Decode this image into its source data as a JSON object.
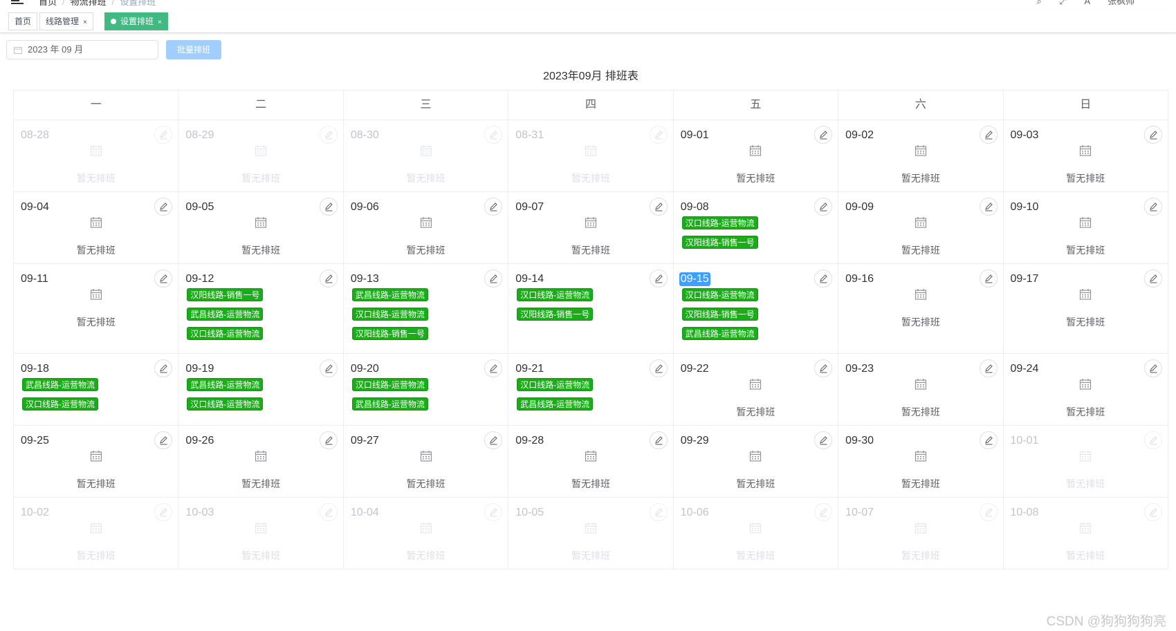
{
  "breadcrumb": {
    "items": [
      "首页",
      "物流排班",
      "设置排班"
    ]
  },
  "header_right": {
    "user": "张枫帅"
  },
  "tags": [
    {
      "label": "首页",
      "closable": false,
      "active": false
    },
    {
      "label": "线路管理",
      "closable": true,
      "active": false
    },
    {
      "label": "设置排班",
      "closable": true,
      "active": true
    }
  ],
  "toolbar": {
    "month_value": "2023 年 09 月",
    "batch_button": "批量排班"
  },
  "calendar": {
    "title": "2023年09月 排班表",
    "weekdays": [
      "一",
      "二",
      "三",
      "四",
      "五",
      "六",
      "日"
    ],
    "empty_text": "暂无排班",
    "weeks": [
      [
        {
          "date": "08-28",
          "other": true,
          "schedules": []
        },
        {
          "date": "08-29",
          "other": true,
          "schedules": []
        },
        {
          "date": "08-30",
          "other": true,
          "schedules": []
        },
        {
          "date": "08-31",
          "other": true,
          "schedules": []
        },
        {
          "date": "09-01",
          "other": false,
          "schedules": []
        },
        {
          "date": "09-02",
          "other": false,
          "schedules": []
        },
        {
          "date": "09-03",
          "other": false,
          "schedules": []
        }
      ],
      [
        {
          "date": "09-04",
          "other": false,
          "schedules": []
        },
        {
          "date": "09-05",
          "other": false,
          "schedules": []
        },
        {
          "date": "09-06",
          "other": false,
          "schedules": []
        },
        {
          "date": "09-07",
          "other": false,
          "schedules": []
        },
        {
          "date": "09-08",
          "other": false,
          "schedules": [
            "汉口线路-运营物流",
            "汉阳线路-销售一号"
          ]
        },
        {
          "date": "09-09",
          "other": false,
          "schedules": []
        },
        {
          "date": "09-10",
          "other": false,
          "schedules": []
        }
      ],
      [
        {
          "date": "09-11",
          "other": false,
          "schedules": []
        },
        {
          "date": "09-12",
          "other": false,
          "schedules": [
            "汉阳线路-销售一号",
            "武昌线路-运营物流",
            "汉口线路-运营物流"
          ]
        },
        {
          "date": "09-13",
          "other": false,
          "schedules": [
            "武昌线路-运营物流",
            "汉口线路-运营物流",
            "汉阳线路-销售一号"
          ]
        },
        {
          "date": "09-14",
          "other": false,
          "schedules": [
            "汉口线路-运营物流",
            "汉阳线路-销售一号"
          ]
        },
        {
          "date": "09-15",
          "other": false,
          "today": true,
          "schedules": [
            "汉口线路-运营物流",
            "汉阳线路-销售一号",
            "武昌线路-运营物流"
          ]
        },
        {
          "date": "09-16",
          "other": false,
          "schedules": []
        },
        {
          "date": "09-17",
          "other": false,
          "schedules": []
        }
      ],
      [
        {
          "date": "09-18",
          "other": false,
          "schedules": [
            "武昌线路-运营物流",
            "汉口线路-运营物流"
          ]
        },
        {
          "date": "09-19",
          "other": false,
          "schedules": [
            "武昌线路-运营物流",
            "汉口线路-运营物流"
          ]
        },
        {
          "date": "09-20",
          "other": false,
          "schedules": [
            "汉口线路-运营物流",
            "武昌线路-运营物流"
          ]
        },
        {
          "date": "09-21",
          "other": false,
          "schedules": [
            "汉口线路-运营物流",
            "武昌线路-运营物流"
          ]
        },
        {
          "date": "09-22",
          "other": false,
          "schedules": []
        },
        {
          "date": "09-23",
          "other": false,
          "schedules": []
        },
        {
          "date": "09-24",
          "other": false,
          "schedules": []
        }
      ],
      [
        {
          "date": "09-25",
          "other": false,
          "schedules": []
        },
        {
          "date": "09-26",
          "other": false,
          "schedules": []
        },
        {
          "date": "09-27",
          "other": false,
          "schedules": []
        },
        {
          "date": "09-28",
          "other": false,
          "schedules": []
        },
        {
          "date": "09-29",
          "other": false,
          "schedules": []
        },
        {
          "date": "09-30",
          "other": false,
          "schedules": []
        },
        {
          "date": "10-01",
          "other": true,
          "schedules": []
        }
      ],
      [
        {
          "date": "10-02",
          "other": true,
          "schedules": []
        },
        {
          "date": "10-03",
          "other": true,
          "schedules": []
        },
        {
          "date": "10-04",
          "other": true,
          "schedules": []
        },
        {
          "date": "10-05",
          "other": true,
          "schedules": []
        },
        {
          "date": "10-06",
          "other": true,
          "schedules": []
        },
        {
          "date": "10-07",
          "other": true,
          "schedules": []
        },
        {
          "date": "10-08",
          "other": true,
          "schedules": []
        }
      ]
    ]
  },
  "watermark": "CSDN @狗狗狗狗亮",
  "colors": {
    "schedule_tag": "#1aad19",
    "today_badge": "#409eff",
    "active_tab": "#42b983",
    "batch_button": "#a0cfff"
  },
  "icons": {
    "menu": "hamburger-icon",
    "calendar": "calendar-icon",
    "edit": "edit-pen-icon",
    "close": "close-icon"
  }
}
